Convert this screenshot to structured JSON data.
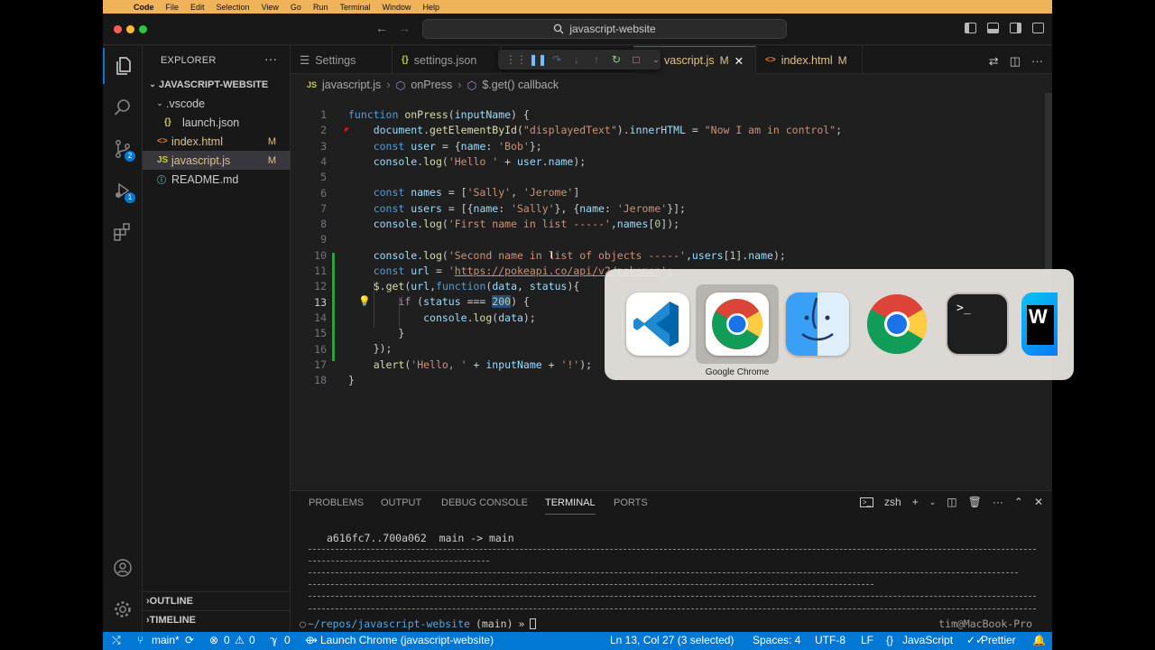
{
  "mac_menu": {
    "items": [
      "Code",
      "File",
      "Edit",
      "Selection",
      "View",
      "Go",
      "Run",
      "Terminal",
      "Window",
      "Help"
    ]
  },
  "titlebar": {
    "search_text": "javascript-website"
  },
  "activity": {
    "scm_badge": "2",
    "debug_badge": "1"
  },
  "sidebar": {
    "title": "EXPLORER",
    "folder": "JAVASCRIPT-WEBSITE",
    "items": [
      {
        "label": ".vscode",
        "icon": "chevron-down-icon",
        "modified": ""
      },
      {
        "label": "launch.json",
        "icon": "json-icon",
        "modified": ""
      },
      {
        "label": "index.html",
        "icon": "html-icon",
        "modified": "M"
      },
      {
        "label": "javascript.js",
        "icon": "js-icon",
        "modified": "M"
      },
      {
        "label": "README.md",
        "icon": "info-icon",
        "modified": ""
      }
    ],
    "outline": "OUTLINE",
    "timeline": "TIMELINE"
  },
  "tabs": [
    {
      "label": "Settings",
      "modified": ""
    },
    {
      "label": "settings.json",
      "modified": ""
    },
    {
      "label": "vascript.js",
      "modified": "M"
    },
    {
      "label": "index.html",
      "modified": "M"
    }
  ],
  "breadcrumb": [
    "javascript.js",
    "onPress",
    "$.get() callback"
  ],
  "code": {
    "line_numbers": [
      "1",
      "2",
      "3",
      "4",
      "5",
      "6",
      "7",
      "8",
      "9",
      "10",
      "11",
      "12",
      "13",
      "14",
      "15",
      "16",
      "17",
      "18"
    ],
    "current_line": "13"
  },
  "panel": {
    "tabs": [
      "PROBLEMS",
      "OUTPUT",
      "DEBUG CONSOLE",
      "TERMINAL",
      "PORTS"
    ],
    "active_tab": "TERMINAL",
    "shell": "zsh",
    "git_line": "a616fc7..700a062  main -> main",
    "prompt_path": "~/repos/javascript-website",
    "prompt_branch": "(main)",
    "prompt_symbol": "»",
    "right_prompt": "tim@MacBook-Pro"
  },
  "statusbar": {
    "branch": "main*",
    "errors": "0",
    "warnings": "0",
    "ports": "0",
    "launch": "Launch Chrome (javascript-website)",
    "position": "Ln 13, Col 27 (3 selected)",
    "spaces": "Spaces: 4",
    "encoding": "UTF-8",
    "eol": "LF",
    "language": "JavaScript",
    "formatter": "Prettier"
  },
  "app_switcher": {
    "apps": [
      "vscode-icon",
      "chrome-icon",
      "finder-icon",
      "chrome-icon",
      "terminal-icon",
      "webstorm-icon"
    ],
    "selected_label": "Google Chrome"
  },
  "colors": {
    "accent": "#0078d4",
    "menubar": "#f1b35a",
    "modified": "#e2c08d"
  }
}
